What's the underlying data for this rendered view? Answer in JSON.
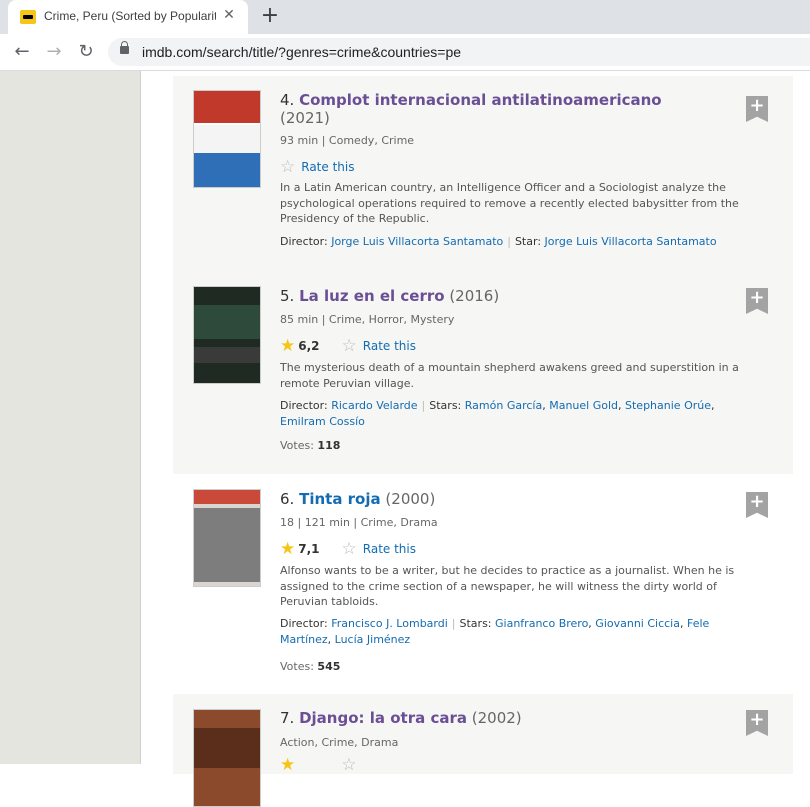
{
  "browser": {
    "tab_title": "Crime, Peru (Sorted by Popularity",
    "tab_close": "✕",
    "new_tab": "+",
    "url": "imdb.com/search/title/?genres=crime&countries=pe",
    "back": "←",
    "forward": "→",
    "reload": "↻"
  },
  "results": [
    {
      "index": "4.",
      "title": "Complot internacional antilatinoamericano",
      "year": "(2021)",
      "meta": "93 min | Comedy, Crime",
      "rate_this": "Rate this",
      "description": "In a Latin American country, an Intelligence Officer and a Sociologist analyze the psychological operations required to remove a recently elected babysitter from the Presidency of the Republic.",
      "director_label": "Director:",
      "director": "Jorge Luis Villacorta Santamato",
      "stars_label": "Star:",
      "stars": [
        "Jorge Luis Villacorta Santamato"
      ]
    },
    {
      "index": "5.",
      "title": "La luz en el cerro",
      "year": "(2016)",
      "meta": "85 min | Crime, Horror, Mystery",
      "rating": "6,2",
      "rate_this": "Rate this",
      "description": "The mysterious death of a mountain shepherd awakens greed and superstition in a remote Peruvian village.",
      "director_label": "Director:",
      "director": "Ricardo Velarde",
      "stars_label": "Stars:",
      "stars": [
        "Ramón García",
        "Manuel Gold",
        "Stephanie Orúe",
        "Emilram Cossío"
      ],
      "votes_label": "Votes:",
      "votes": "118"
    },
    {
      "index": "6.",
      "title": "Tinta roja",
      "year": "(2000)",
      "meta": "18 | 121 min | Crime, Drama",
      "rating": "7,1",
      "rate_this": "Rate this",
      "description": "Alfonso wants to be a writer, but he decides to practice as a journalist. When he is assigned to the crime section of a newspaper, he will witness the dirty world of Peruvian tabloids.",
      "director_label": "Director:",
      "director": "Francisco J. Lombardi",
      "stars_label": "Stars:",
      "stars": [
        "Gianfranco Brero",
        "Giovanni Ciccia",
        "Fele Martínez",
        "Lucía Jiménez"
      ],
      "votes_label": "Votes:",
      "votes": "545"
    },
    {
      "index": "7.",
      "title": "Django: la otra cara",
      "year": "(2002)",
      "meta": "Action, Crime, Drama"
    }
  ],
  "add_label": "+",
  "star_glyph": "★",
  "star_empty_glyph": "☆",
  "poster_colors": {
    "poster1_top": "#c0392b",
    "poster2": "#1e2a22",
    "poster3": "#8a8a8a",
    "poster4": "#8b4a2b"
  }
}
